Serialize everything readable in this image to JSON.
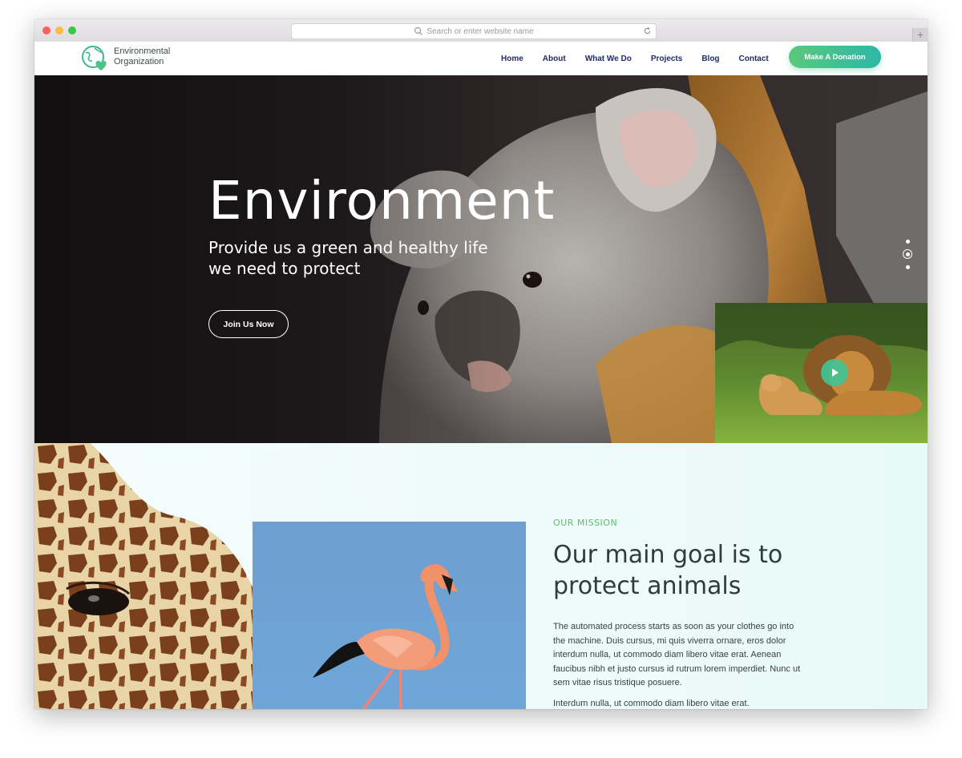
{
  "browser": {
    "address_placeholder": "Search or enter website name",
    "new_tab": "+"
  },
  "nav": {
    "logo_line1": "Environmental",
    "logo_line2": "Organization",
    "menu": [
      "Home",
      "About",
      "What We Do",
      "Projects",
      "Blog",
      "Contact"
    ],
    "donate_label": "Make A Donation"
  },
  "hero": {
    "title": "Environment",
    "subtitle_line1": "Provide us a green and healthy life",
    "subtitle_line2": "we need to protect",
    "cta_label": "Join Us Now",
    "slide_count": 3,
    "active_slide": 2
  },
  "mission": {
    "kicker": "OUR MISSION",
    "title_line1": "Our main goal is to",
    "title_line2": "protect animals",
    "paragraph1": "The automated process starts as soon as your clothes go into the machine. Duis cursus, mi quis viverra ornare, eros dolor interdum nulla, ut commodo diam libero vitae erat. Aenean faucibus nibh et justo cursus id rutrum lorem imperdiet. Nunc ut sem vitae risus tristique posuere.",
    "paragraph2": "Interdum nulla, ut commodo diam libero vitae erat."
  },
  "colors": {
    "accent_green": "#5fbf6a",
    "button_gradient_start": "#5ac97d",
    "button_gradient_end": "#2cb7a7",
    "nav_text": "#1f2a6b",
    "heading_text": "#2e3d37"
  },
  "icons": {
    "address_search": "search-icon",
    "address_reload": "reload-icon",
    "logo": "globe-heart-icon",
    "video": "play-icon"
  }
}
